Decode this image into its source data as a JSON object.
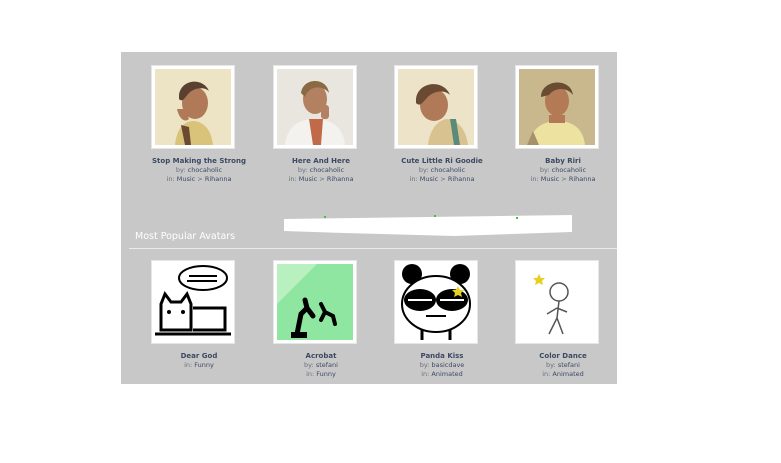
{
  "top_avatars": [
    {
      "title": "Stop Making the Strong",
      "by_label": "by:",
      "author": "chocaholic",
      "in_label": "in:",
      "category": "Music",
      "separator": ">",
      "subcategory": "Rihanna",
      "icon": "person-photo-icon"
    },
    {
      "title": "Here And Here",
      "by_label": "by:",
      "author": "chocaholic",
      "in_label": "in:",
      "category": "Music",
      "separator": ">",
      "subcategory": "Rihanna",
      "icon": "person-photo-icon"
    },
    {
      "title": "Cute Little Ri Goodie",
      "by_label": "by:",
      "author": "chocaholic",
      "in_label": "in:",
      "category": "Music",
      "separator": ">",
      "subcategory": "Rihanna",
      "icon": "person-photo-icon"
    },
    {
      "title": "Baby Riri",
      "by_label": "by:",
      "author": "chocaholic",
      "in_label": "in:",
      "category": "Music",
      "separator": ">",
      "subcategory": "Rihanna",
      "icon": "person-photo-icon"
    }
  ],
  "section_heading": "Most Popular Avatars",
  "popular_avatars": [
    {
      "title": "Dear God",
      "by_label": "in:",
      "author": "Funny",
      "in_label": "",
      "category": "",
      "separator": "",
      "subcategory": "",
      "icon": "cartoon-cat-icon"
    },
    {
      "title": "Acrobat",
      "by_label": "by:",
      "author": "stefani",
      "in_label": "in:",
      "category": "Funny",
      "separator": "",
      "subcategory": "",
      "icon": "stick-acrobat-icon"
    },
    {
      "title": "Panda Kiss",
      "by_label": "by:",
      "author": "basicdave",
      "in_label": "in:",
      "category": "Animated",
      "separator": "",
      "subcategory": "",
      "icon": "panda-icon"
    },
    {
      "title": "Color Dance",
      "by_label": "by:",
      "author": "stefani",
      "in_label": "in:",
      "category": "Animated",
      "separator": "",
      "subcategory": "",
      "icon": "stick-figure-icon"
    }
  ],
  "colors": {
    "panel": "#c8c8c8",
    "link": "#3c4963",
    "heading": "#ffffff"
  }
}
